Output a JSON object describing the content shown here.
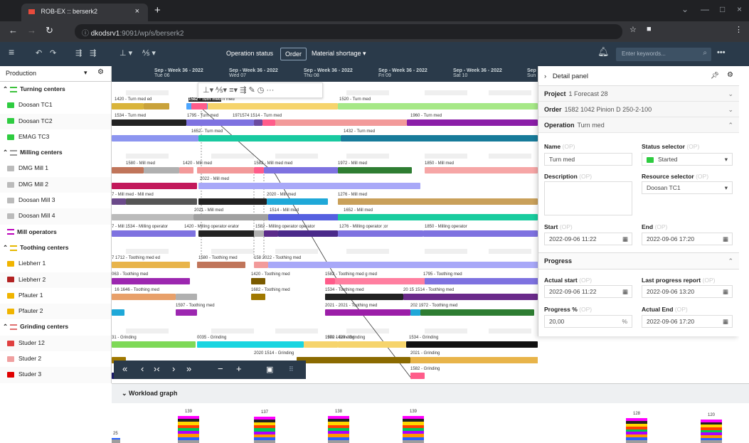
{
  "browser": {
    "tab_title": "ROB-EX :: berserk2",
    "url_host": "dkodsrv1",
    "url_rest": ":9091/wp/s/berserk2"
  },
  "toolbar": {
    "operation_status": "Operation status",
    "order": "Order",
    "material_shortage": "Material shortage",
    "search_placeholder": "Enter keywords..."
  },
  "sidebar": {
    "selector": "Production",
    "rows": [
      {
        "type": "group",
        "label": "Turning centers",
        "color": "#3cc13c"
      },
      {
        "type": "res",
        "label": "Doosan TC1",
        "color": "#2ecc40"
      },
      {
        "type": "res",
        "label": "Doosan TC2",
        "color": "#2ecc40"
      },
      {
        "type": "res",
        "label": "EMAG TC3",
        "color": "#2ecc40"
      },
      {
        "type": "group",
        "label": "Milling centers",
        "color": "#999999"
      },
      {
        "type": "res",
        "label": "DMG Mill 1",
        "color": "#bbbbbb"
      },
      {
        "type": "res",
        "label": "DMG Mill 2",
        "color": "#bbbbbb"
      },
      {
        "type": "res",
        "label": "Doosan Mill 3",
        "color": "#bbbbbb"
      },
      {
        "type": "res",
        "label": "Doosan Mill 4",
        "color": "#bbbbbb"
      },
      {
        "type": "op",
        "label": "Mill operators",
        "color": "#b0b"
      },
      {
        "type": "group",
        "label": "Toothing centers",
        "color": "#e6b800"
      },
      {
        "type": "res",
        "label": "Liebherr 1",
        "color": "#f0b400"
      },
      {
        "type": "res",
        "label": "Liebherr 2",
        "color": "#b22222"
      },
      {
        "type": "res",
        "label": "Pfauter 1",
        "color": "#f0b400"
      },
      {
        "type": "res",
        "label": "Pfauter 2",
        "color": "#f0b400"
      },
      {
        "type": "group",
        "label": "Grinding centers",
        "color": "#e07070"
      },
      {
        "type": "res",
        "label": "Studer 12",
        "color": "#e04040"
      },
      {
        "type": "res",
        "label": "Studer 2",
        "color": "#f0a0a0"
      },
      {
        "type": "res",
        "label": "Studer 3",
        "color": "#e00000"
      }
    ]
  },
  "dates": [
    {
      "week": "Sep - Week 36 - 2022",
      "day": "Tue 06"
    },
    {
      "week": "Sep - Week 36 - 2022",
      "day": "Wed 07"
    },
    {
      "week": "Sep - Week 36 - 2022",
      "day": "Thu 08"
    },
    {
      "week": "Sep - Week 36 - 2022",
      "day": "Fri 09"
    },
    {
      "week": "Sep - Week 36 - 2022",
      "day": "Sat 10"
    },
    {
      "week": "Sep",
      "day": "Sun"
    }
  ],
  "gantt_labels": [
    "1420 - Turn med ed",
    "1582 - Turn med",
    "n med",
    "1520 - Turn med",
    "1534 - Turn med",
    "1795 - Turn med",
    "1971574 1514 - Turn med",
    "1960 - Turn med",
    "1652 - Turn med",
    "1432 - Turn med",
    "1580 - Mill med",
    "1420 - Mill med",
    "1582 - Mill med med",
    "1972 - Mill med",
    "1850 - Mill med",
    "2022 - Mill med",
    "7 - Mill med - Mill med",
    "2020 - Mill med",
    "1276 - Mill med",
    "2021 - Mill med",
    "1514 - Mill med",
    "1652 - Mill med",
    "7 - Mill 1534 - Milling operator",
    "1420 - Milling operator erator",
    "1582 - Milling operator operator",
    "1276 - Milling operator ;or",
    "1850 - Milling operator",
    "7 1712 - Toothing med ed",
    "1580 - Toothing med",
    "158 2022 - Toothing med",
    "063 - Toothing med",
    "1420 - Toothing med",
    "1582 - Toothing med g med",
    "1795 - Toothing med",
    "16 1646 - Toothing med",
    "1682 - Toothing med",
    "1534 - Toothing med",
    "20 15 1514 - Toothing med",
    "1597 - Toothing med",
    "2021 - 2021 - Toothing med",
    "202 1972 - Toothing med",
    "31 - Grinding",
    "0035 - Grinding",
    "1580 1420 - Grinding",
    "1534 - Grinding",
    "1972 - Grinding",
    "2021 - Grinding",
    "2020 1514 - Grinding",
    "1582 - Grinding",
    "1795 - Grinding"
  ],
  "navbar": {
    "first": "«",
    "prev": "‹",
    "fit": "›‹",
    "next": "›",
    "last": "»",
    "zoom_out": "−",
    "zoom_in": "+"
  },
  "workload": {
    "title": "Workload graph",
    "values": [
      "25",
      "139",
      "137",
      "138",
      "139",
      "128",
      "120"
    ]
  },
  "detail_panel": {
    "title": "Detail panel",
    "project_label": "Project",
    "project_value": "1 Forecast 28",
    "order_label": "Order",
    "order_value": "1582 1042 Pinion D 250-2-100",
    "operation_label": "Operation",
    "operation_value": "Turn med",
    "name_label": "Name",
    "name_value": "Turn med",
    "status_label": "Status selector",
    "status_value": "Started",
    "description_label": "Description",
    "resource_label": "Resource selector",
    "resource_value": "Doosan TC1",
    "start_label": "Start",
    "start_value": "2022-09-06 11:22",
    "end_label": "End",
    "end_value": "2022-09-06 17:20",
    "progress_title": "Progress",
    "actual_start_label": "Actual start",
    "actual_start_value": "2022-09-06 11:22",
    "last_report_label": "Last progress report",
    "last_report_value": "2022-09-06 13:20",
    "progress_label": "Progress %",
    "progress_value": "20,00",
    "progress_unit": "%",
    "actual_end_label": "Actual End",
    "actual_end_value": "2022-09-06 17:20",
    "op_tag": "(OP)"
  }
}
